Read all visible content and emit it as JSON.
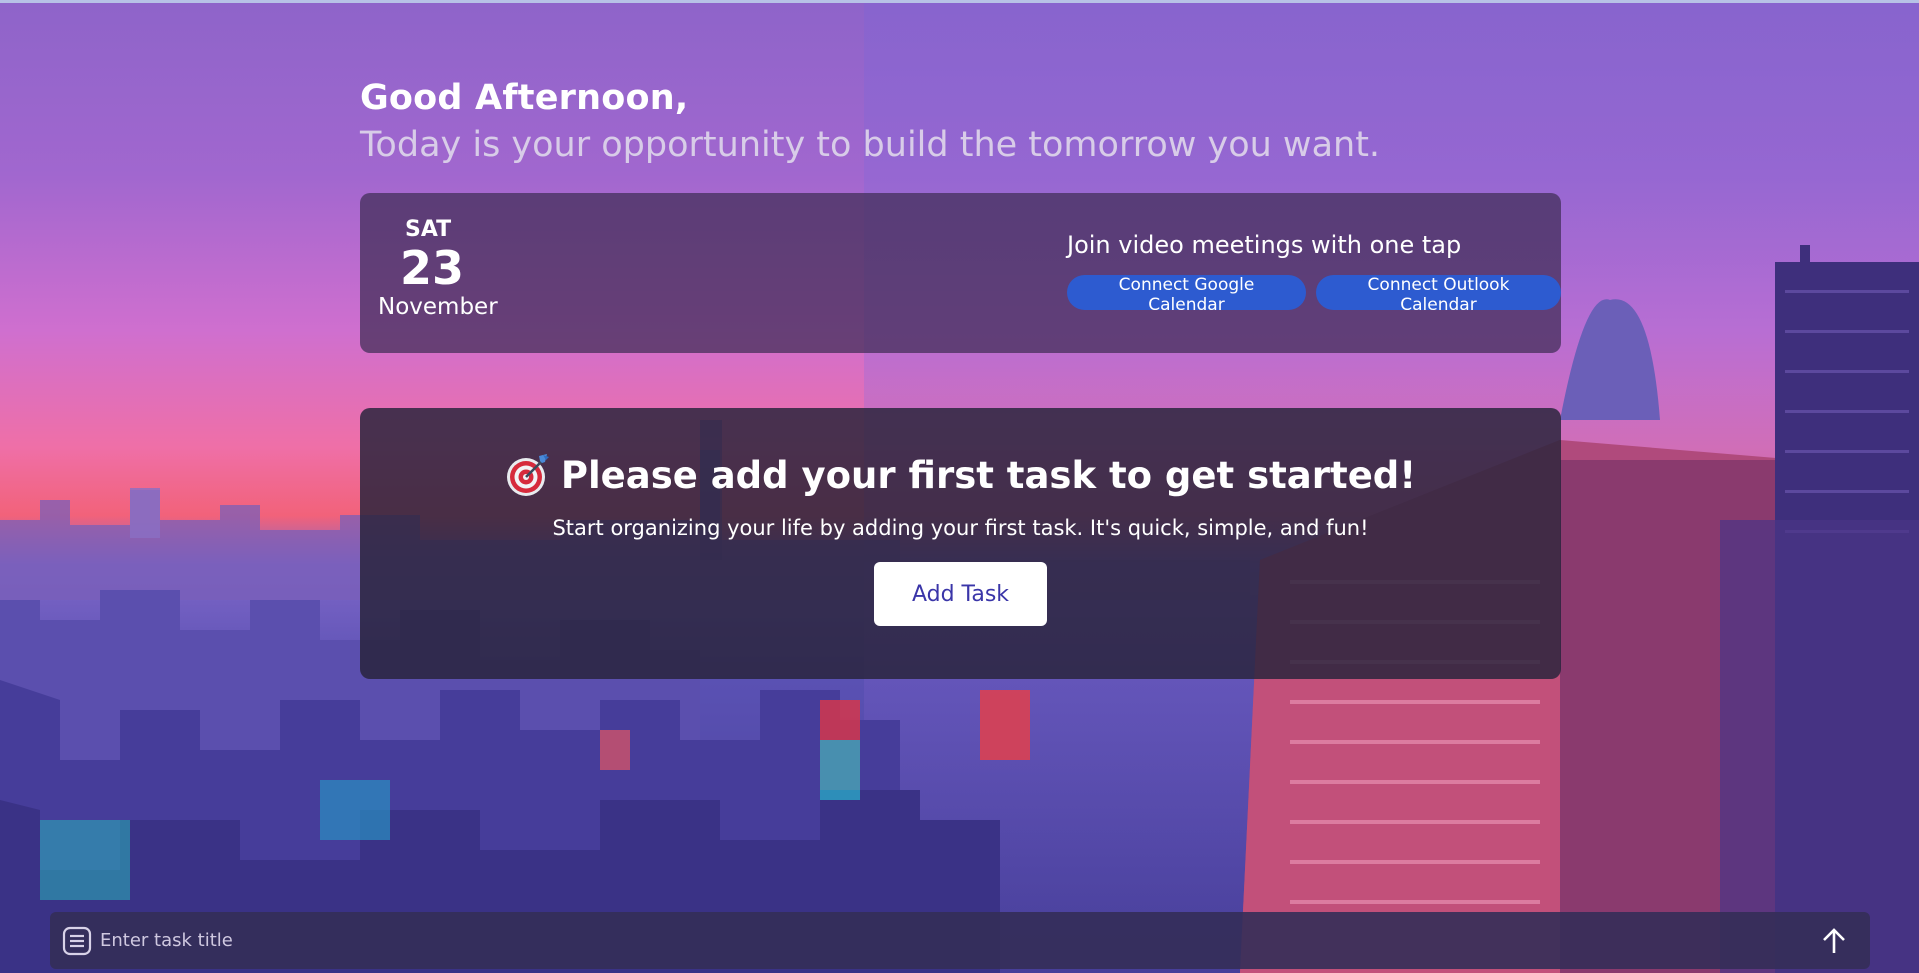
{
  "greeting": {
    "title": "Good Afternoon,",
    "subtitle": "Today is your opportunity to build the tomorrow you want."
  },
  "date": {
    "day": "SAT",
    "number": "23",
    "month": "November"
  },
  "meetings": {
    "title": "Join video meetings with one tap",
    "google_label": "Connect Google Calendar",
    "outlook_label": "Connect Outlook Calendar"
  },
  "task_prompt": {
    "icon": "target-icon",
    "title": "Please add your first task to get started!",
    "description": "Start organizing your life by adding your first task. It's quick, simple, and fun!",
    "button_label": "Add Task"
  },
  "task_input": {
    "placeholder": "Enter task title",
    "icon": "note-icon",
    "submit_icon": "arrow-up-icon"
  },
  "colors": {
    "accent_button": "#2d5bd0",
    "add_task_text": "#3a35a8"
  }
}
